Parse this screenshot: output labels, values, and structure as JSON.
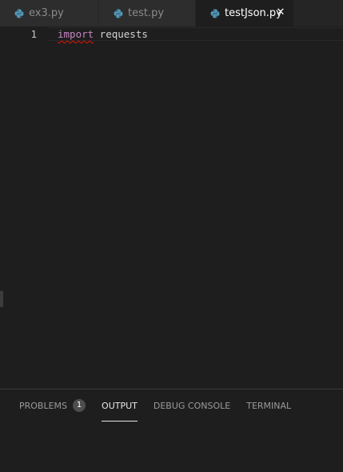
{
  "tabs": [
    {
      "label": "ex3.py",
      "active": false
    },
    {
      "label": "test.py",
      "active": false
    },
    {
      "label": "testJson.py",
      "active": true,
      "close_glyph": "✕"
    }
  ],
  "editor": {
    "lines": [
      {
        "number": "1",
        "keyword": "import",
        "rest": " requests"
      }
    ]
  },
  "panel": {
    "tabs": [
      {
        "label": "PROBLEMS",
        "badge": "1",
        "active": false
      },
      {
        "label": "OUTPUT",
        "active": true
      },
      {
        "label": "DEBUG CONSOLE",
        "active": false
      },
      {
        "label": "TERMINAL",
        "active": false
      }
    ]
  },
  "colors": {
    "background": "#1e1e1e",
    "tab_inactive": "#2d2d2d",
    "keyword": "#c586c0",
    "error_squiggle": "#e51400",
    "python_icon": "#519aba"
  },
  "icons": {
    "file_icon": "python-icon",
    "close_icon": "close-icon"
  }
}
